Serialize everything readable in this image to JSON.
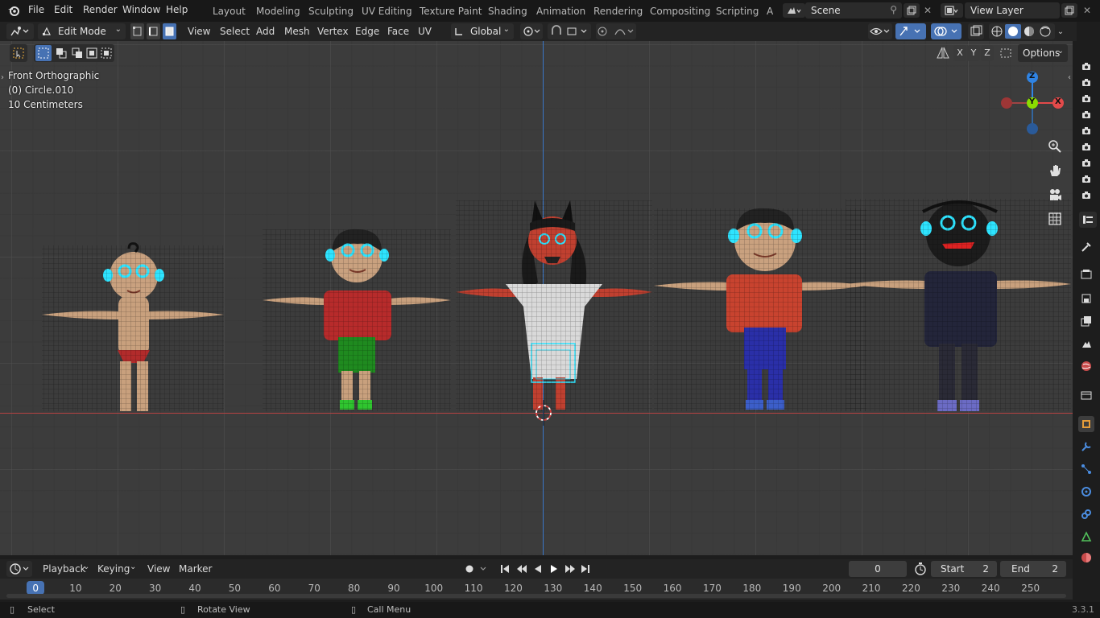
{
  "menubar": {
    "menu": [
      "File",
      "Edit",
      "Render",
      "Window",
      "Help"
    ],
    "workspaces": [
      "Layout",
      "Modeling",
      "Sculpting",
      "UV Editing",
      "Texture Paint",
      "Shading",
      "Animation",
      "Rendering",
      "Compositing",
      "Scripting",
      "A"
    ],
    "scene": "Scene",
    "view_layer": "View Layer"
  },
  "header": {
    "mode": "Edit Mode",
    "menus": [
      "View",
      "Select",
      "Add",
      "Mesh",
      "Vertex",
      "Edge",
      "Face",
      "UV"
    ],
    "transform_orientation": "Global",
    "axes": [
      "X",
      "Y",
      "Z"
    ],
    "options_label": "Options"
  },
  "viewport": {
    "view_name": "Front Orthographic",
    "object_name": "(0) Circle.010",
    "scale_label": "10 Centimeters",
    "gizmo_axes": [
      "Z",
      "Y",
      "X"
    ]
  },
  "timeline": {
    "menus": [
      "Playback",
      "Keying",
      "View",
      "Marker"
    ],
    "current_frame": "0",
    "start_label": "Start",
    "start_value": "2",
    "end_label": "End",
    "end_value": "2",
    "ruler_ticks": [
      "0",
      "10",
      "20",
      "30",
      "40",
      "50",
      "60",
      "70",
      "80",
      "90",
      "100",
      "110",
      "120",
      "130",
      "140",
      "150",
      "160",
      "170",
      "180",
      "190",
      "200",
      "210",
      "220",
      "230",
      "240",
      "250"
    ]
  },
  "status": {
    "select": "Select",
    "rotate": "Rotate View",
    "call_menu": "Call Menu",
    "version": "3.3.1"
  },
  "colors": {
    "accent": "#4772b3",
    "x_axis": "#e34a4a",
    "y_axis": "#8bdc00",
    "z_axis": "#2f83e3",
    "selection": "#2ee4ff"
  }
}
